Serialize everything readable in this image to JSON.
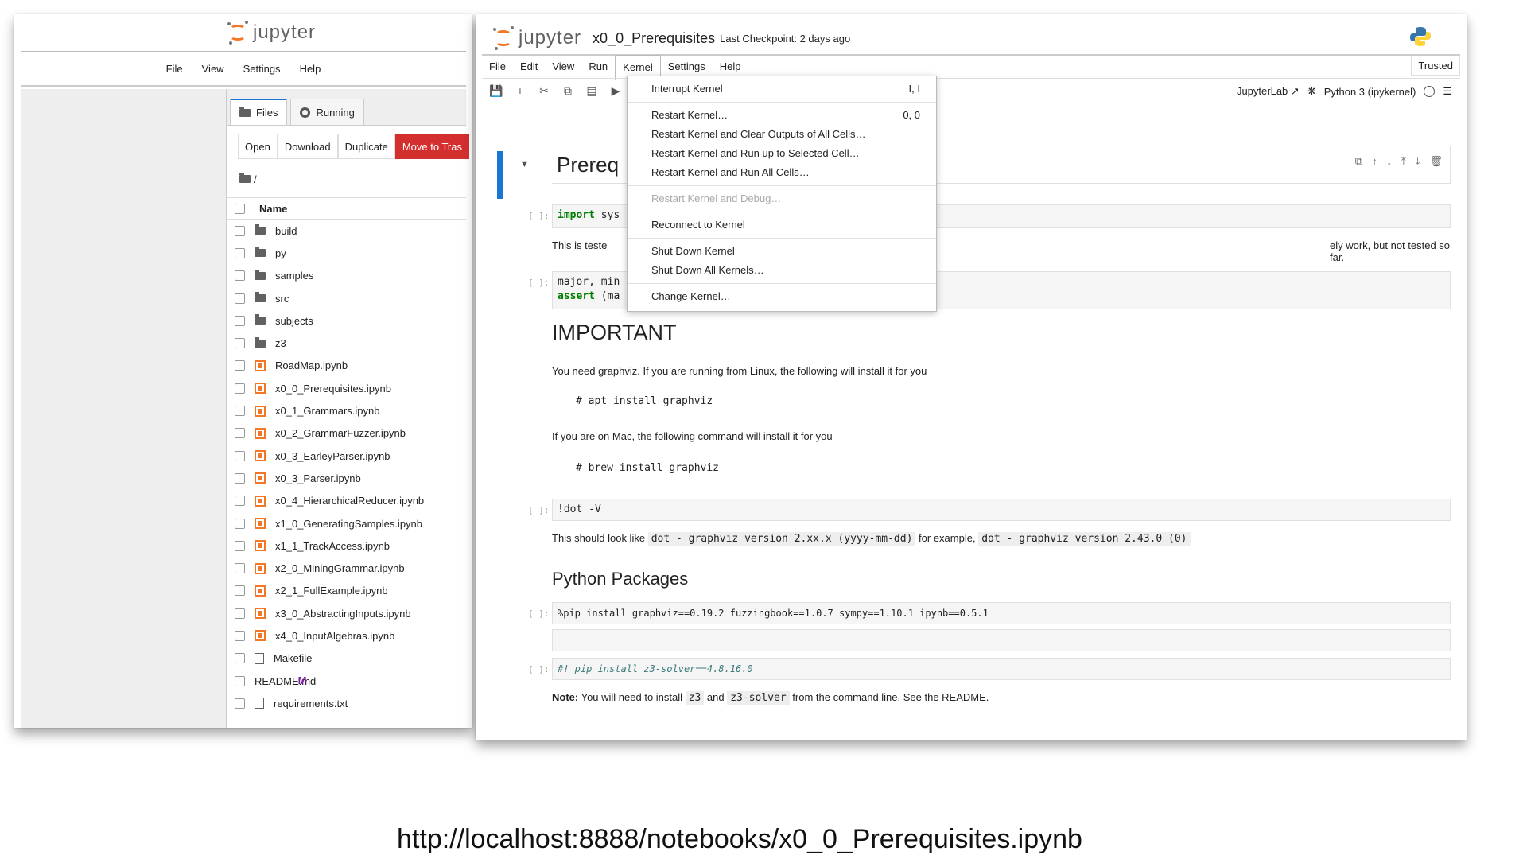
{
  "left_window": {
    "brand": "jupyter",
    "menu": [
      "File",
      "View",
      "Settings",
      "Help"
    ],
    "tabs": [
      "Files",
      "Running"
    ],
    "actions": [
      "Open",
      "Download",
      "Duplicate",
      "Move to Tras"
    ],
    "breadcrumb": "/",
    "column_name": "Name",
    "files": [
      {
        "name": "build",
        "icon": "folder-icon"
      },
      {
        "name": "py",
        "icon": "folder-icon"
      },
      {
        "name": "samples",
        "icon": "folder-icon"
      },
      {
        "name": "src",
        "icon": "folder-icon"
      },
      {
        "name": "subjects",
        "icon": "folder-icon"
      },
      {
        "name": "z3",
        "icon": "folder-icon"
      },
      {
        "name": "RoadMap.ipynb",
        "icon": "notebook-icon"
      },
      {
        "name": "x0_0_Prerequisites.ipynb",
        "icon": "notebook-icon"
      },
      {
        "name": "x0_1_Grammars.ipynb",
        "icon": "notebook-icon"
      },
      {
        "name": "x0_2_GrammarFuzzer.ipynb",
        "icon": "notebook-icon"
      },
      {
        "name": "x0_3_EarleyParser.ipynb",
        "icon": "notebook-icon"
      },
      {
        "name": "x0_3_Parser.ipynb",
        "icon": "notebook-icon"
      },
      {
        "name": "x0_4_HierarchicalReducer.ipynb",
        "icon": "notebook-icon"
      },
      {
        "name": "x1_0_GeneratingSamples.ipynb",
        "icon": "notebook-icon"
      },
      {
        "name": "x1_1_TrackAccess.ipynb",
        "icon": "notebook-icon"
      },
      {
        "name": "x2_0_MiningGrammar.ipynb",
        "icon": "notebook-icon"
      },
      {
        "name": "x2_1_FullExample.ipynb",
        "icon": "notebook-icon"
      },
      {
        "name": "x3_0_AbstractingInputs.ipynb",
        "icon": "notebook-icon"
      },
      {
        "name": "x4_0_InputAlgebras.ipynb",
        "icon": "notebook-icon"
      },
      {
        "name": "Makefile",
        "icon": "file-icon"
      },
      {
        "name": "README.md",
        "icon": "markdown-icon"
      },
      {
        "name": "requirements.txt",
        "icon": "file-icon"
      }
    ]
  },
  "right_window": {
    "brand": "jupyter",
    "notebook_title": "x0_0_Prerequisites",
    "checkpoint": "Last Checkpoint: 2 days ago",
    "menu": [
      "File",
      "Edit",
      "View",
      "Run",
      "Kernel",
      "Settings",
      "Help"
    ],
    "trusted": "Trusted",
    "jupyterlab_link": "JupyterLab",
    "kernel_name": "Python 3 (ipykernel)",
    "heading_partial": "Prereq",
    "prompt": "[ ]:",
    "cell1_kw": "import",
    "cell1_rest": " sys",
    "text_partial_left": "This is teste",
    "text_partial_right": "ely work, but not tested so far.",
    "cell2_line1": "major, min",
    "cell2_kw": "assert",
    "cell2_rest": " (ma",
    "important_heading": "IMPORTANT",
    "graphviz_text": "You need graphviz. If you are running from Linux, the following will install it for you",
    "apt_cmd": "# apt install graphviz",
    "mac_text": "If you are on Mac, the following command will install it for you",
    "brew_cmd": "# brew install graphviz",
    "dot_cmd": "!dot -V",
    "dot_text_a": "This should look like",
    "dot_code_a": "dot - graphviz version 2.xx.x (yyyy-mm-dd)",
    "dot_text_b": "for example,",
    "dot_code_b": "dot - graphviz version 2.43.0 (0)",
    "packages_heading": "Python Packages",
    "pip_cmd": "%pip install graphviz==0.19.2 fuzzingbook==1.0.7 sympy==1.10.1 ipynb==0.5.1",
    "z3_cmd": "#! pip install z3-solver==4.8.16.0",
    "note_bold": "Note:",
    "note_a": " You will need to install ",
    "note_code_a": "z3",
    "note_b": " and ",
    "note_code_b": "z3-solver",
    "note_c": " from the command line. See the README."
  },
  "kernel_menu": [
    {
      "label": "Interrupt Kernel",
      "shortcut": "I, I",
      "disabled": false
    },
    {
      "label": "Restart Kernel…",
      "shortcut": "0, 0",
      "disabled": false
    },
    {
      "label": "Restart Kernel and Clear Outputs of All Cells…",
      "shortcut": "",
      "disabled": false
    },
    {
      "label": "Restart Kernel and Run up to Selected Cell…",
      "shortcut": "",
      "disabled": false
    },
    {
      "label": "Restart Kernel and Run All Cells…",
      "shortcut": "",
      "disabled": false
    },
    {
      "label": "Restart Kernel and Debug…",
      "shortcut": "",
      "disabled": true
    },
    {
      "label": "Reconnect to Kernel",
      "shortcut": "",
      "disabled": false
    },
    {
      "label": "Shut Down Kernel",
      "shortcut": "",
      "disabled": false
    },
    {
      "label": "Shut Down All Kernels…",
      "shortcut": "",
      "disabled": false
    },
    {
      "label": "Change Kernel…",
      "shortcut": "",
      "disabled": false
    }
  ],
  "url_caption": "http://localhost:8888/notebooks/x0_0_Prerequisites.ipynb",
  "colors": {
    "accent": "#1976d2",
    "jupyter_orange": "#f37726",
    "danger": "#d32f2f"
  }
}
